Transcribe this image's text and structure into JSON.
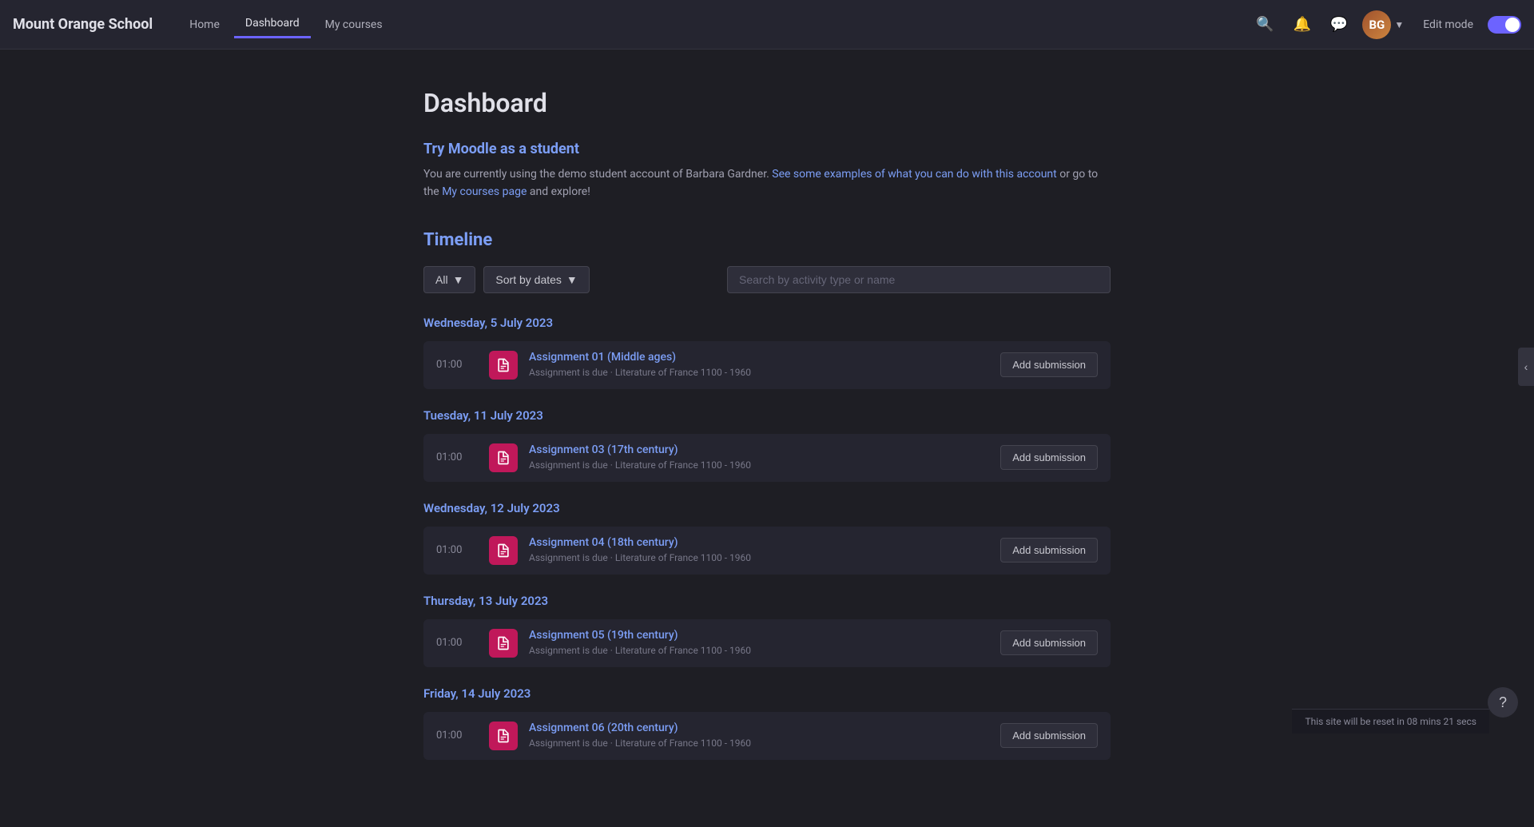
{
  "brand": {
    "name": "Mount Orange School"
  },
  "navbar": {
    "links": [
      {
        "id": "home",
        "label": "Home",
        "active": false
      },
      {
        "id": "dashboard",
        "label": "Dashboard",
        "active": true
      },
      {
        "id": "my-courses",
        "label": "My courses",
        "active": false
      }
    ],
    "edit_mode_label": "Edit mode",
    "avatar_initials": "BG"
  },
  "dashboard": {
    "title": "Dashboard",
    "try_moodle": {
      "heading": "Try Moodle as a student",
      "text_part1": "You are currently using the demo student account of Barbara Gardner. See some examples of what you can do with this account or go to the My courses page and explore!"
    },
    "timeline": {
      "heading": "Timeline",
      "filter_all_label": "All",
      "sort_by_dates_label": "Sort by dates",
      "search_placeholder": "Search by activity type or name",
      "date_groups": [
        {
          "id": "wed-5-july-2023",
          "date_label": "Wednesday, 5 July 2023",
          "assignments": [
            {
              "time": "01:00",
              "name": "Assignment 01 (Middle ages)",
              "meta": "Assignment is due · Literature of France 1100 - 1960",
              "btn_label": "Add submission"
            }
          ]
        },
        {
          "id": "tue-11-july-2023",
          "date_label": "Tuesday, 11 July 2023",
          "assignments": [
            {
              "time": "01:00",
              "name": "Assignment 03 (17th century)",
              "meta": "Assignment is due · Literature of France 1100 - 1960",
              "btn_label": "Add submission"
            }
          ]
        },
        {
          "id": "wed-12-july-2023",
          "date_label": "Wednesday, 12 July 2023",
          "assignments": [
            {
              "time": "01:00",
              "name": "Assignment 04 (18th century)",
              "meta": "Assignment is due · Literature of France 1100 - 1960",
              "btn_label": "Add submission"
            }
          ]
        },
        {
          "id": "thu-13-july-2023",
          "date_label": "Thursday, 13 July 2023",
          "assignments": [
            {
              "time": "01:00",
              "name": "Assignment 05 (19th century)",
              "meta": "Assignment is due · Literature of France 1100 - 1960",
              "btn_label": "Add submission"
            }
          ]
        },
        {
          "id": "fri-14-july-2023",
          "date_label": "Friday, 14 July 2023",
          "assignments": [
            {
              "time": "01:00",
              "name": "Assignment 06 (20th century)",
              "meta": "Assignment is due · Literature of France 1100 - 1960",
              "btn_label": "Add submission"
            }
          ]
        }
      ]
    }
  },
  "reset_notice": {
    "text": "This site will be reset in 08 mins 21 secs"
  },
  "help_btn_label": "?"
}
